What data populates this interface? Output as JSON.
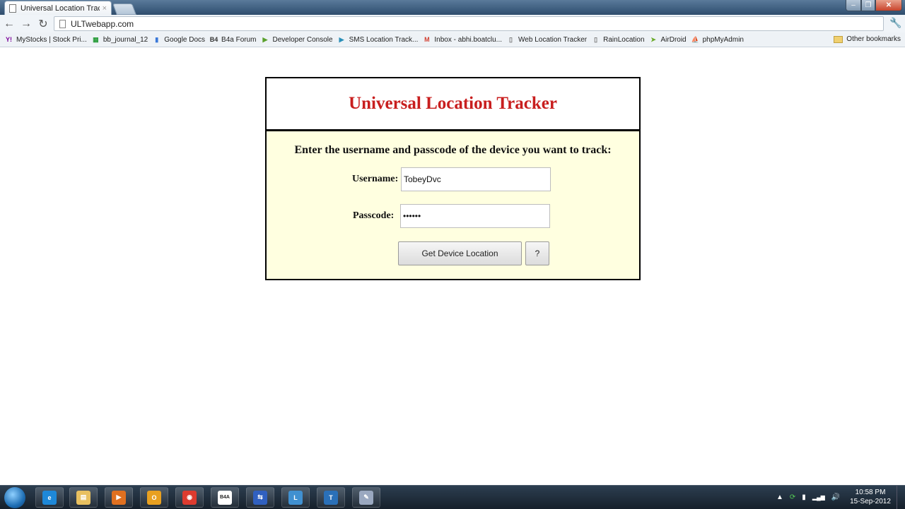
{
  "browser": {
    "tab_title": "Universal Location Tracker",
    "tab_close": "×",
    "url": "ULTwebapp.com",
    "window_controls": {
      "minimize": "–",
      "maximize": "❐",
      "close": "✕"
    },
    "nav": {
      "back": "←",
      "forward": "→",
      "reload": "↻"
    },
    "wrench": "🔧"
  },
  "bookmarks": [
    {
      "label": "MyStocks | Stock Pri...",
      "icon": "yahoo-icon",
      "glyph": "Y!",
      "color": "#7b0099"
    },
    {
      "label": "bb_journal_12",
      "icon": "spreadsheet-icon",
      "glyph": "▦",
      "color": "#2a9d3c"
    },
    {
      "label": "Google Docs",
      "icon": "docs-icon",
      "glyph": "▮",
      "color": "#3a78d8"
    },
    {
      "label": "B4a Forum",
      "icon": "b4a-icon",
      "glyph": "B4",
      "color": "#333333"
    },
    {
      "label": "Developer Console",
      "icon": "play-icon",
      "glyph": "▶",
      "color": "#5aa02c"
    },
    {
      "label": "SMS Location Track...",
      "icon": "play-icon",
      "glyph": "▶",
      "color": "#2a8fb8"
    },
    {
      "label": "Inbox - abhi.boatclu...",
      "icon": "gmail-icon",
      "glyph": "M",
      "color": "#d23f31"
    },
    {
      "label": "Web Location Tracker",
      "icon": "page-icon",
      "glyph": "▯",
      "color": "#777777"
    },
    {
      "label": "RainLocation",
      "icon": "page-icon",
      "glyph": "▯",
      "color": "#777777"
    },
    {
      "label": "AirDroid",
      "icon": "airdroid-icon",
      "glyph": "➤",
      "color": "#6aaa2a"
    },
    {
      "label": "phpMyAdmin",
      "icon": "phpmyadmin-icon",
      "glyph": "⛵",
      "color": "#e0a020"
    }
  ],
  "other_bookmarks": "Other bookmarks",
  "app": {
    "title": "Universal Location Tracker",
    "prompt": "Enter the username and passcode of the device you want to track:",
    "username_label": "Username:",
    "username_value": "TobeyDvc",
    "passcode_label": "Passcode:",
    "passcode_value": "••••••",
    "submit_label": "Get Device Location",
    "help_label": "?",
    "title_color": "#c81e1e",
    "form_bg": "#ffffe0"
  },
  "taskbar": {
    "apps": [
      {
        "name": "internet-explorer",
        "glyph": "e",
        "color": "#1e88d8"
      },
      {
        "name": "file-explorer",
        "glyph": "▤",
        "color": "#e8c060"
      },
      {
        "name": "media-player",
        "glyph": "▶",
        "color": "#e07020"
      },
      {
        "name": "outlook",
        "glyph": "O",
        "color": "#e8a020"
      },
      {
        "name": "chrome",
        "glyph": "◉",
        "color": "#dd3b2f"
      },
      {
        "name": "basic4android",
        "glyph": "B4A",
        "color": "#ffffff"
      },
      {
        "name": "network-tool",
        "glyph": "⇆",
        "color": "#3060c0"
      },
      {
        "name": "lync",
        "glyph": "L",
        "color": "#4090d0"
      },
      {
        "name": "text-tool",
        "glyph": "T",
        "color": "#2a70b8"
      },
      {
        "name": "paint",
        "glyph": "✎",
        "color": "#9aa8c0"
      }
    ],
    "tray": {
      "show_hidden": "▲",
      "sync": "⟳",
      "power": "▮",
      "signal": "▂▄▆",
      "volume": "🔊"
    },
    "time": "10:58 PM",
    "date": "15-Sep-2012"
  }
}
